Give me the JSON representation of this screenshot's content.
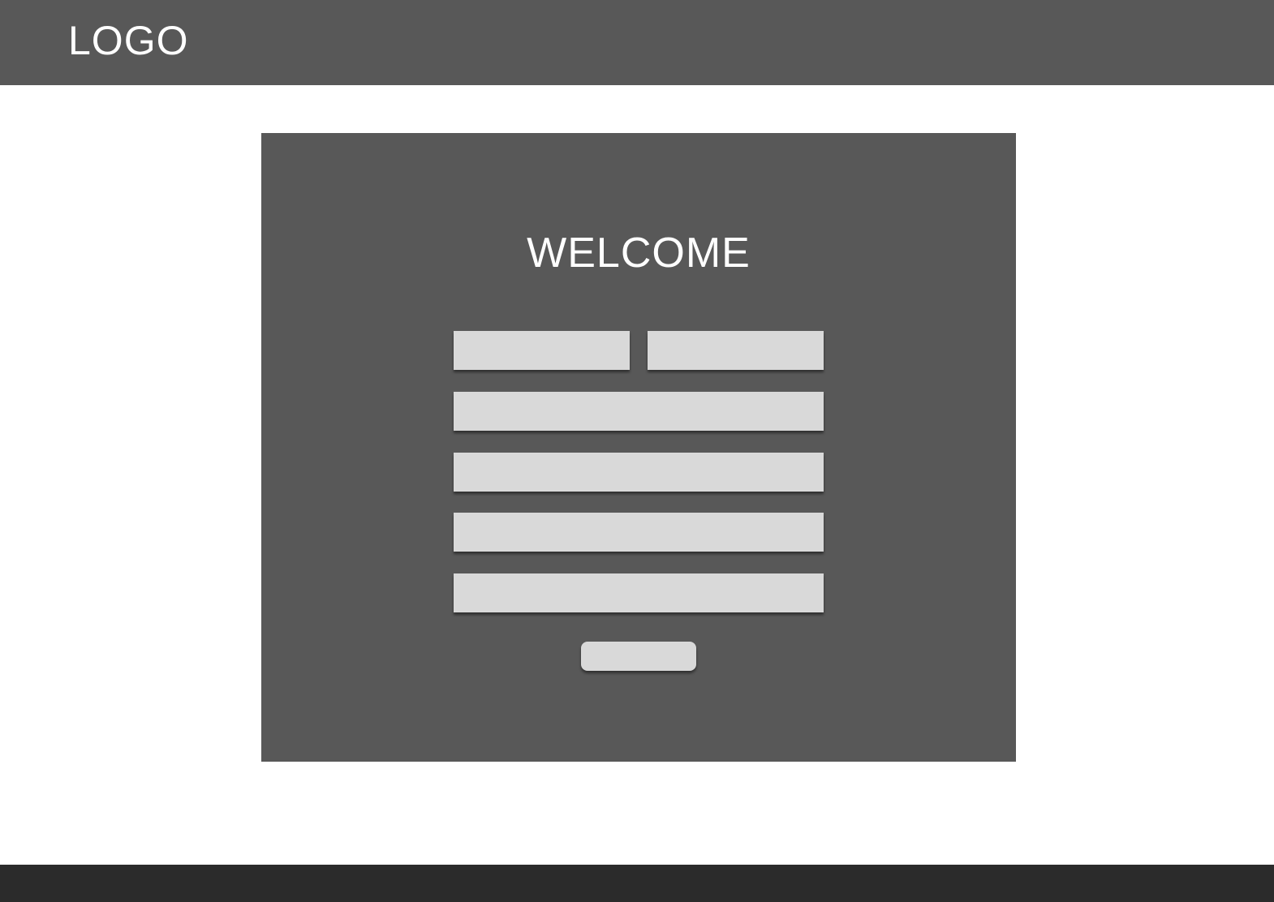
{
  "header": {
    "logo_text": "LOGO"
  },
  "form": {
    "title": "WELCOME",
    "fields": {
      "first_name": {
        "value": "",
        "placeholder": ""
      },
      "last_name": {
        "value": "",
        "placeholder": ""
      },
      "field_3": {
        "value": "",
        "placeholder": ""
      },
      "field_4": {
        "value": "",
        "placeholder": ""
      },
      "field_5": {
        "value": "",
        "placeholder": ""
      },
      "field_6": {
        "value": "",
        "placeholder": ""
      }
    },
    "submit_label": ""
  },
  "footer": {},
  "colors": {
    "header_bg": "#585858",
    "card_bg": "#585858",
    "field_bg": "#d9d9d9",
    "footer_bg": "#2b2b2b",
    "text_light": "#ffffff"
  }
}
